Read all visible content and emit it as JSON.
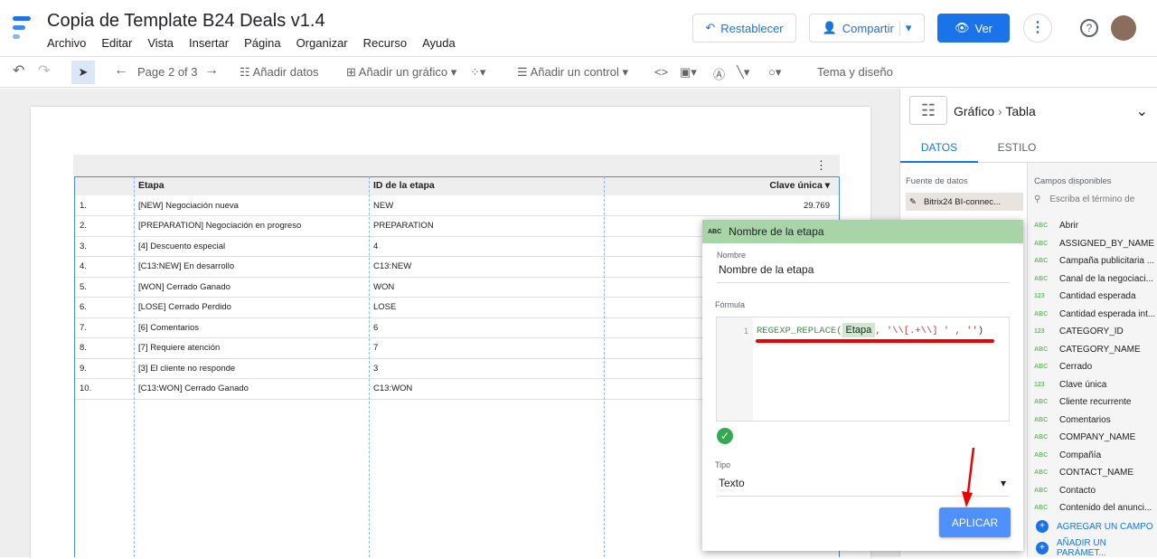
{
  "header": {
    "title": "Copia de Template B24 Deals v1.4",
    "menu": [
      "Archivo",
      "Editar",
      "Vista",
      "Insertar",
      "Página",
      "Organizar",
      "Recurso",
      "Ayuda"
    ],
    "reset": "Restablecer",
    "share": "Compartir",
    "view": "Ver"
  },
  "toolbar": {
    "page": "Page 2 of 3",
    "add_data": "Añadir datos",
    "add_chart": "Añadir un gráfico",
    "add_control": "Añadir un control",
    "theme": "Tema y diseño"
  },
  "table": {
    "headers": [
      "",
      "Etapa",
      "ID de la etapa",
      "Clave única"
    ],
    "rows": [
      [
        "1.",
        "[NEW] Negociación nueva",
        "NEW",
        "29.769"
      ],
      [
        "2.",
        "[PREPARATION] Negociación en progreso",
        "PREPARATION",
        ""
      ],
      [
        "3.",
        "[4] Descuento especial",
        "4",
        ""
      ],
      [
        "4.",
        "[C13:NEW] En desarrollo",
        "C13:NEW",
        ""
      ],
      [
        "5.",
        "[WON] Cerrado Ganado",
        "WON",
        ""
      ],
      [
        "6.",
        "[LOSE] Cerrado Perdido",
        "LOSE",
        ""
      ],
      [
        "7.",
        "[6] Comentarios",
        "6",
        ""
      ],
      [
        "8.",
        "[7] Requiere atención",
        "7",
        ""
      ],
      [
        "9.",
        "[3] El cliente no responde",
        "3",
        ""
      ],
      [
        "10.",
        "[C13:WON] Cerrado Ganado",
        "C13:WON",
        ""
      ]
    ]
  },
  "panel": {
    "chart": "Gráfico",
    "chart_type": "Tabla",
    "tabs": [
      "DATOS",
      "ESTILO"
    ],
    "source_label": "Fuente de datos",
    "source": "Bitrix24 BI-connec...",
    "fields_label": "Campos disponibles",
    "search_placeholder": "Escriba el término de",
    "fields": [
      [
        "ABC",
        "Abrir"
      ],
      [
        "ABC",
        "ASSIGNED_BY_NAME"
      ],
      [
        "ABC",
        "Campaña publicitaria ..."
      ],
      [
        "ABC",
        "Canal de la negociaci..."
      ],
      [
        "123",
        "Cantidad esperada"
      ],
      [
        "ABC",
        "Cantidad esperada int..."
      ],
      [
        "123",
        "CATEGORY_ID"
      ],
      [
        "ABC",
        "CATEGORY_NAME"
      ],
      [
        "ABC",
        "Cerrado"
      ],
      [
        "123",
        "Clave única"
      ],
      [
        "ABC",
        "Cliente recurrente"
      ],
      [
        "ABC",
        "Comentarios"
      ],
      [
        "ABC",
        "COMPANY_NAME"
      ],
      [
        "ABC",
        "Compañía"
      ],
      [
        "ABC",
        "CONTACT_NAME"
      ],
      [
        "ABC",
        "Contacto"
      ],
      [
        "ABC",
        "Contenido del anunci..."
      ]
    ],
    "add_field": "AGREGAR UN CAMPO",
    "add_param": "AÑADIR UN PARÁMET..."
  },
  "dialog": {
    "type_icon": "ABC",
    "title": "Nombre de la etapa",
    "name_label": "Nombre",
    "name_value": "Nombre de la etapa",
    "formula_label": "Fórmula",
    "line": "1",
    "fn": "REGEXP_REPLACE(",
    "field": "Etapa",
    "arg1": ", '\\\\[.+\\\\] ' , ''",
    "close": ")",
    "type_label": "Tipo",
    "type_value": "Texto",
    "apply": "APLICAR"
  }
}
